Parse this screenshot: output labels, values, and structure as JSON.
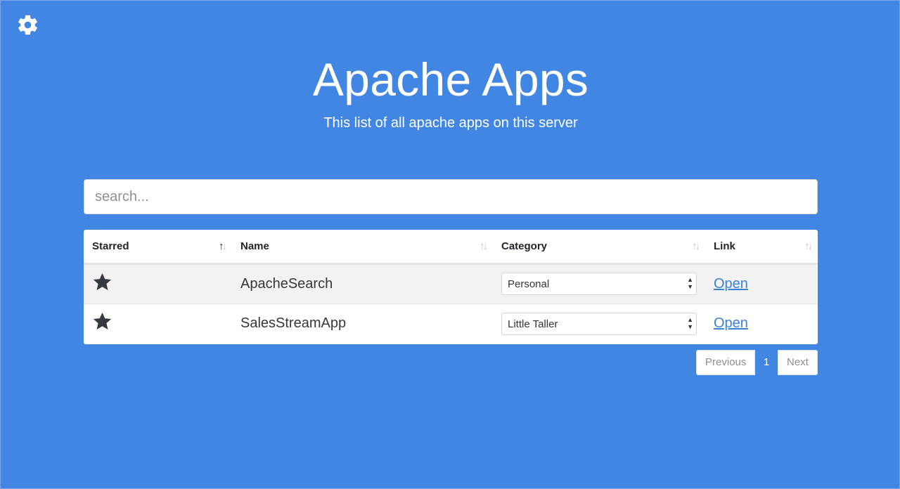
{
  "colors": {
    "background": "#4286e3",
    "text_on_bg": "#ffffff",
    "link": "#3b7fd9"
  },
  "header": {
    "settings_icon": "gear-icon",
    "title": "Apache Apps",
    "subtitle": "This list of all apache apps on this server"
  },
  "search": {
    "placeholder": "search...",
    "value": ""
  },
  "table": {
    "columns": [
      {
        "label": "Starred",
        "sort": "ascending"
      },
      {
        "label": "Name",
        "sort": "none"
      },
      {
        "label": "Category",
        "sort": "none"
      },
      {
        "label": "Link",
        "sort": "none"
      }
    ],
    "rows": [
      {
        "starred": true,
        "star_icon": "star-icon",
        "name": "ApacheSearch",
        "category": "Personal",
        "link": "Open"
      },
      {
        "starred": true,
        "star_icon": "star-icon",
        "name": "SalesStreamApp",
        "category": "Little Taller",
        "link": "Open"
      }
    ]
  },
  "pagination": {
    "previous": "Previous",
    "current": "1",
    "next": "Next"
  }
}
